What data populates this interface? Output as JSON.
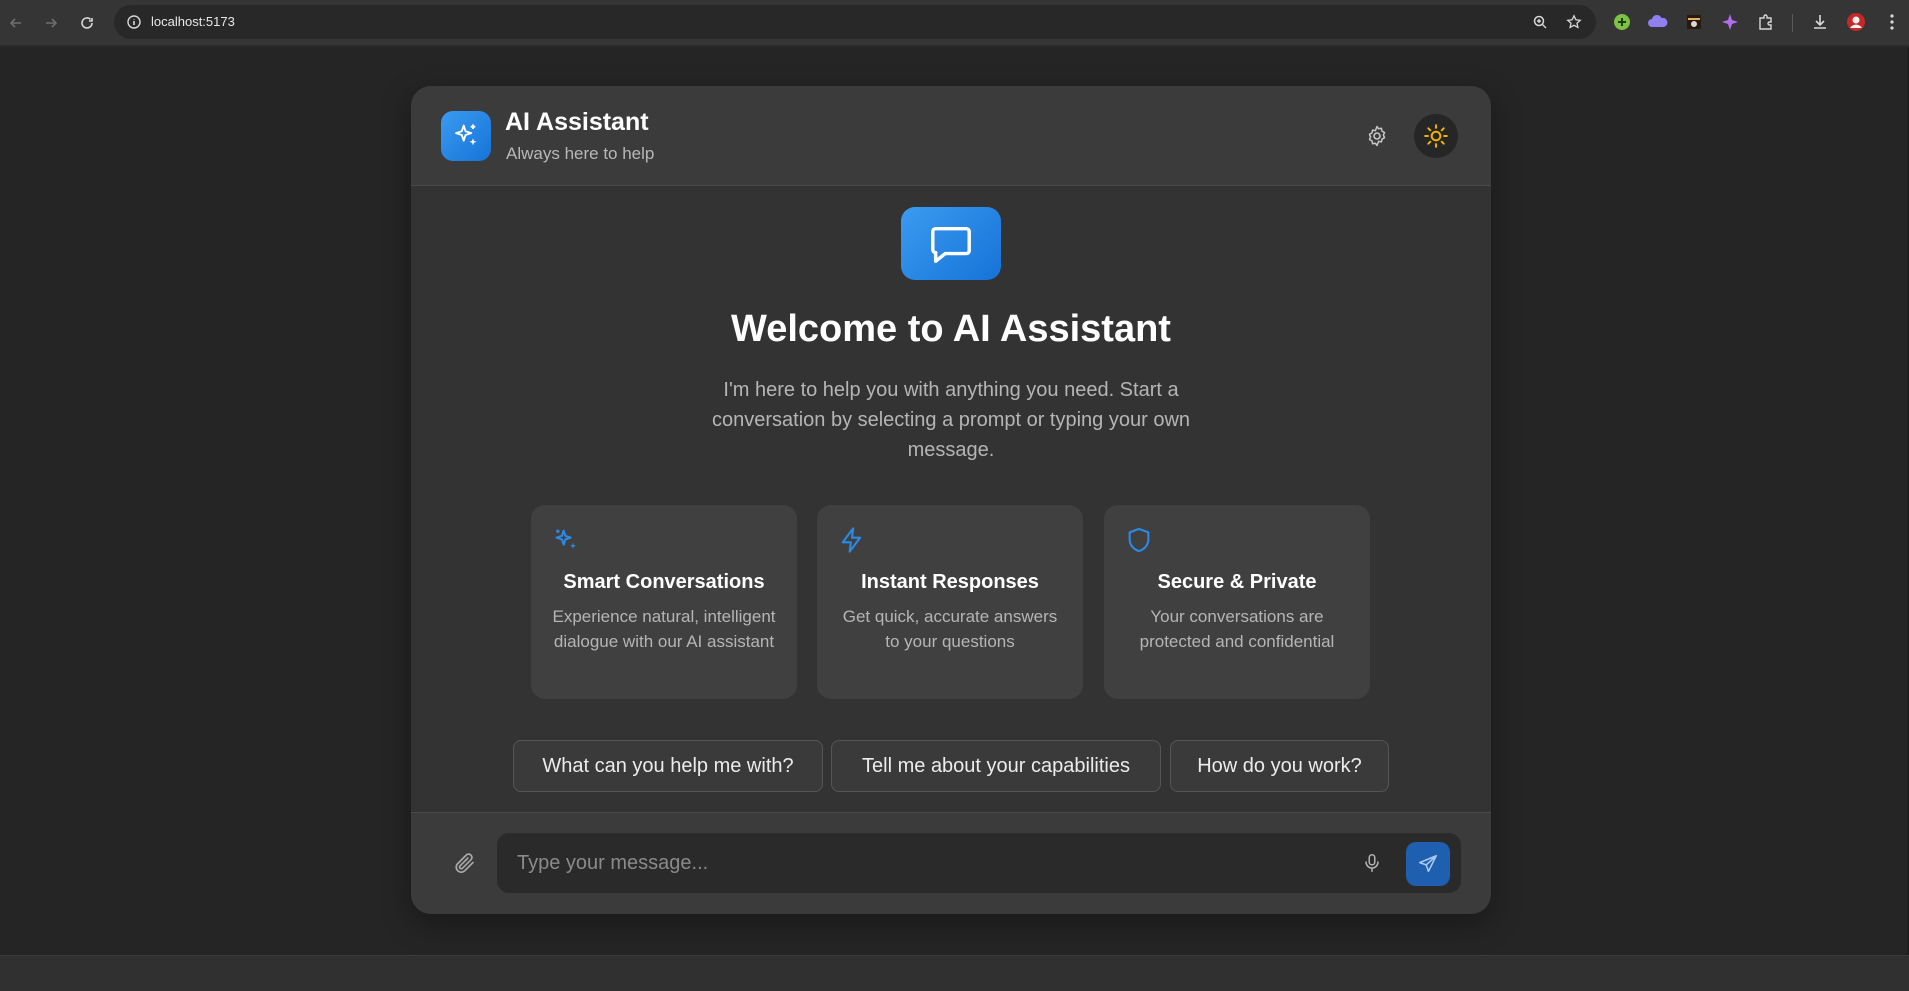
{
  "browser": {
    "url": "localhost:5173",
    "icons": [
      "back-icon",
      "forward-icon",
      "reload-icon",
      "site-info-icon",
      "zoom-icon",
      "bookmark-star-icon",
      "extension-green-icon",
      "extension-cloud-icon",
      "extension-image-icon",
      "extension-sparkle-icon",
      "extensions-puzzle-icon",
      "download-icon",
      "profile-avatar",
      "more-menu-icon"
    ]
  },
  "header": {
    "title": "AI Assistant",
    "subtitle": "Always here to help"
  },
  "hero": {
    "title": "Welcome to AI Assistant",
    "intro": "I'm here to help you with anything you need. Start a conversation by selecting a prompt or typing your own message."
  },
  "features": [
    {
      "icon": "sparkles-icon",
      "title": "Smart Conversations",
      "description": "Experience natural, intelligent dialogue with our AI assistant"
    },
    {
      "icon": "lightning-icon",
      "title": "Instant Responses",
      "description": "Get quick, accurate answers to your questions"
    },
    {
      "icon": "shield-icon",
      "title": "Secure & Private",
      "description": "Your conversations are protected and confidential"
    }
  ],
  "prompts": [
    "What can you help me with?",
    "Tell me about your capabilities",
    "How do you work?"
  ],
  "composer": {
    "placeholder": "Type your message...",
    "value": ""
  },
  "colors": {
    "accent": "#2a8ae6",
    "accent_dark": "#1f5fb0",
    "sun": "#f5b400",
    "background": "#252525",
    "card": "#333333"
  }
}
